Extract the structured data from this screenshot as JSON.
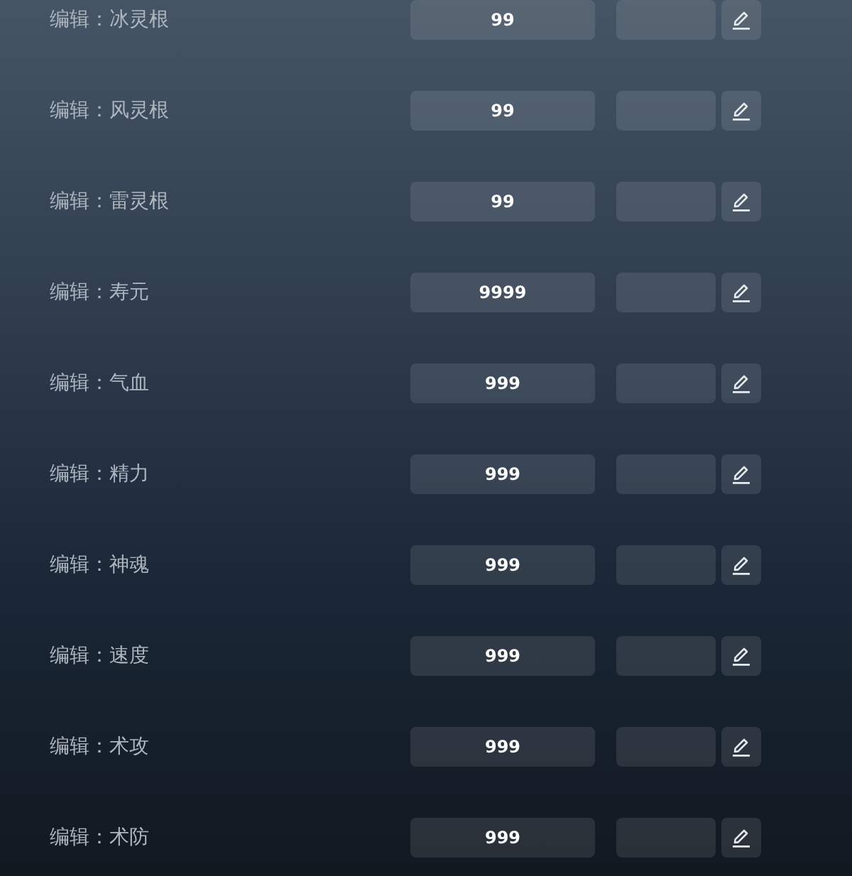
{
  "rows": [
    {
      "label": "编辑：冰灵根",
      "value": "99"
    },
    {
      "label": "编辑：风灵根",
      "value": "99"
    },
    {
      "label": "编辑：雷灵根",
      "value": "99"
    },
    {
      "label": "编辑：寿元",
      "value": "9999"
    },
    {
      "label": "编辑：气血",
      "value": "999"
    },
    {
      "label": "编辑：精力",
      "value": "999"
    },
    {
      "label": "编辑：神魂",
      "value": "999"
    },
    {
      "label": "编辑：速度",
      "value": "999"
    },
    {
      "label": "编辑：术攻",
      "value": "999"
    },
    {
      "label": "编辑：术防",
      "value": "999"
    }
  ]
}
